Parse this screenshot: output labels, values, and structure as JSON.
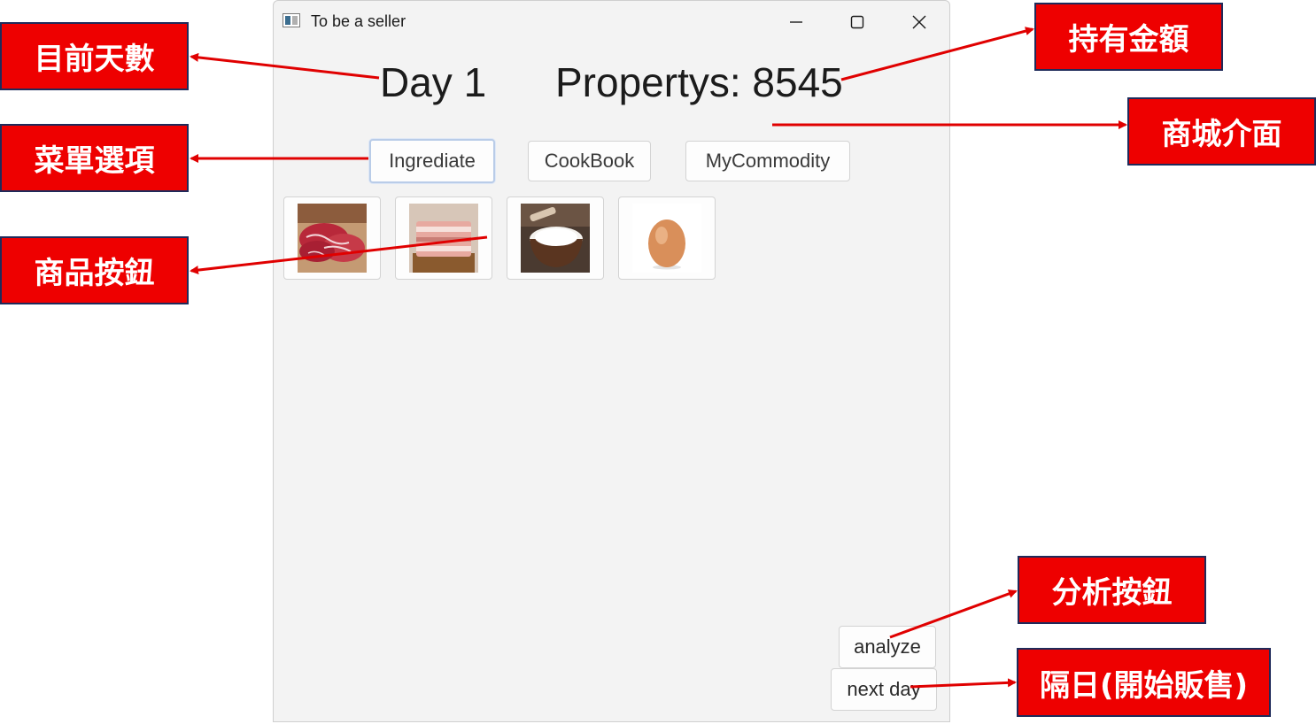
{
  "window": {
    "title": "To be a seller"
  },
  "header": {
    "day_label": "Day 1",
    "property_label": "Propertys: 8545"
  },
  "tabs": [
    {
      "label": "Ingrediate",
      "selected": true
    },
    {
      "label": "CookBook",
      "selected": false
    },
    {
      "label": "MyCommodity",
      "selected": false
    }
  ],
  "items": [
    {
      "icon": "beef-icon"
    },
    {
      "icon": "pork-belly-icon"
    },
    {
      "icon": "flour-icon"
    },
    {
      "icon": "egg-icon"
    }
  ],
  "actions": {
    "analyze": "analyze",
    "next_day": "next day"
  },
  "annotations": {
    "current_day": "目前天數",
    "money_held": "持有金額",
    "shop_interface": "商城介面",
    "menu_options": "菜單選項",
    "item_buttons": "商品按鈕",
    "analyze_button": "分析按鈕",
    "next_day": "隔日(開始販售)"
  },
  "colors": {
    "callout_bg": "#ee0000",
    "callout_border": "#1f2a5a",
    "arrow": "#e00000",
    "window_bg": "#f3f3f3",
    "tab_selected_border": "#b9cce8"
  }
}
